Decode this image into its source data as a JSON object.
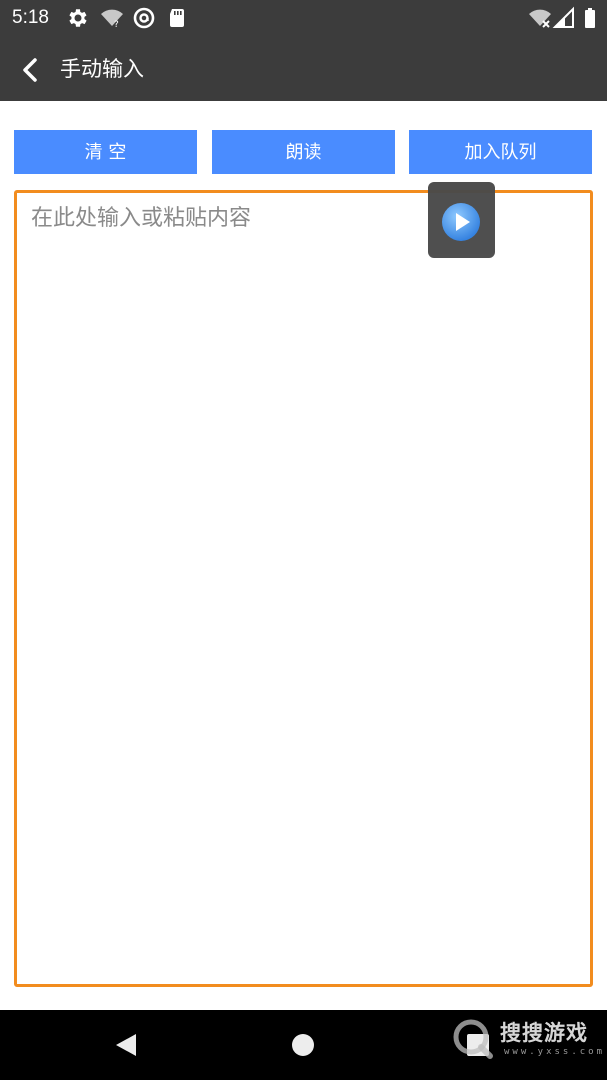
{
  "status_bar": {
    "time": "5:18",
    "icons": [
      "settings-icon",
      "wifi-question-icon",
      "at-sign-icon",
      "sd-card-icon",
      "wifi-off-icon",
      "cellular-signal-icon",
      "battery-icon"
    ]
  },
  "app_bar": {
    "back_icon": "chevron-left-icon",
    "title": "手动输入"
  },
  "toolbar": {
    "clear_label": "清 空",
    "read_label": "朗读",
    "queue_label": "加入队列",
    "button_color": "#4a8cff"
  },
  "editor": {
    "placeholder": "在此处输入或粘贴内容",
    "value": "",
    "border_color": "#f28c1e"
  },
  "floating_player": {
    "icon": "play-circle-icon"
  },
  "nav_bar": {
    "icons": [
      "nav-back-icon",
      "nav-home-icon",
      "nav-recent-icon"
    ]
  },
  "watermark": {
    "text": "搜搜游戏",
    "url": "www.yxss.com"
  },
  "colors": {
    "app_bar_bg": "#3c3c3c",
    "accent_orange": "#f28c1e",
    "accent_blue": "#4a8cff"
  }
}
